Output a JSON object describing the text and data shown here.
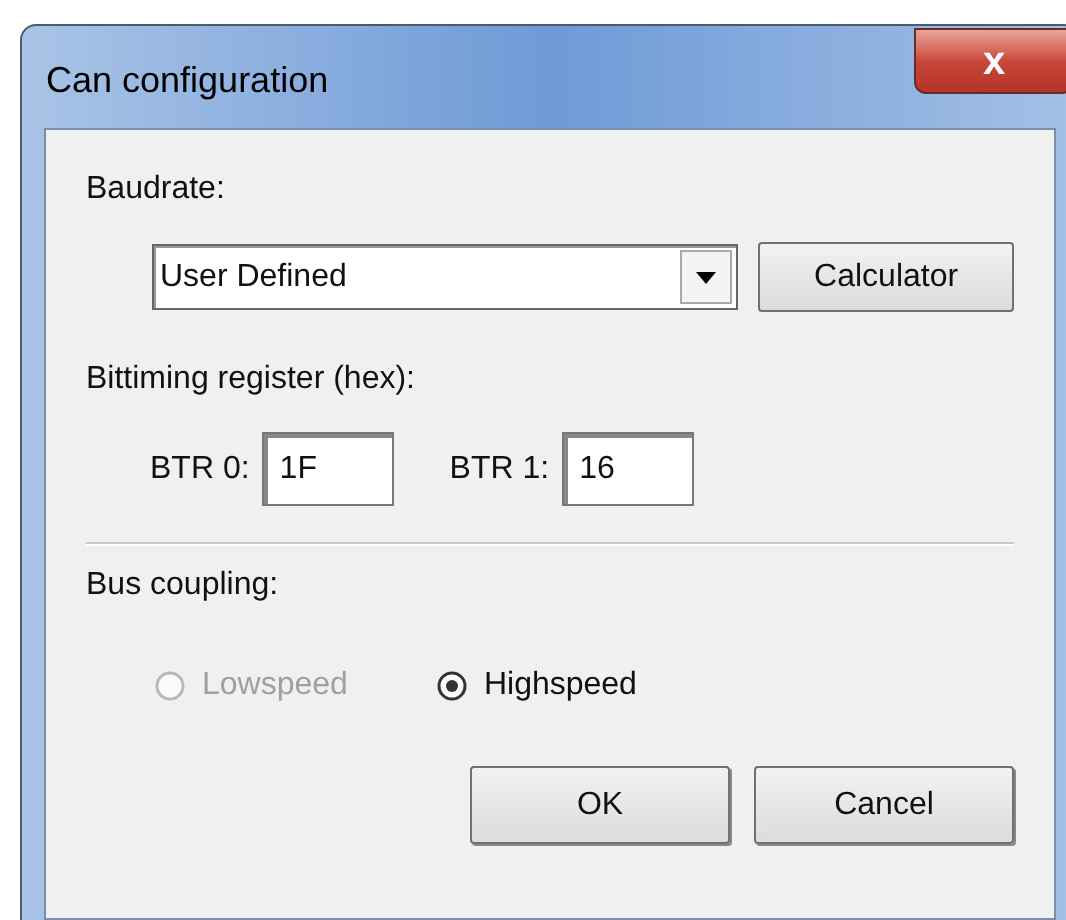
{
  "window": {
    "title": "Can configuration",
    "close": "x"
  },
  "baudrate": {
    "label": "Baudrate:",
    "value": "User Defined",
    "button": "Calculator"
  },
  "bittiming": {
    "label": "Bittiming register (hex):",
    "fields": [
      {
        "label": "BTR 0:",
        "value": "1F"
      },
      {
        "label": "BTR 1:",
        "value": "16"
      }
    ]
  },
  "bus_coupling": {
    "label": "Bus coupling:",
    "options": [
      {
        "label": "Lowspeed",
        "selected": false,
        "disabled": true
      },
      {
        "label": "Highspeed",
        "selected": true,
        "disabled": false
      }
    ]
  },
  "buttons": [
    "OK",
    "Cancel"
  ]
}
